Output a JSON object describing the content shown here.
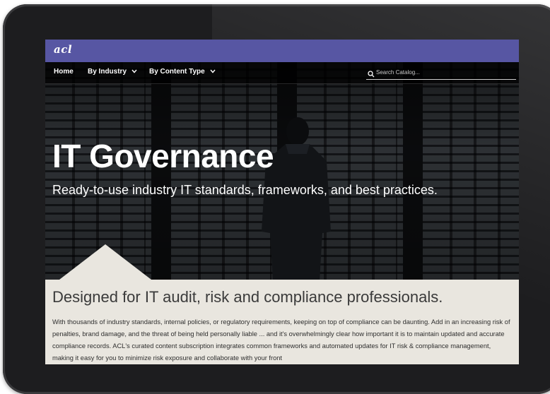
{
  "brand": {
    "logo_text": "acl"
  },
  "nav": {
    "home_label": "Home",
    "by_industry_label": "By Industry",
    "by_content_type_label": "By Content Type",
    "search_placeholder": "Search Catalog..."
  },
  "hero": {
    "title": "IT Governance",
    "subtitle": "Ready-to-use industry IT standards, frameworks, and best practices."
  },
  "content": {
    "heading": "Designed for IT audit, risk and compliance professionals.",
    "body": "With thousands of industry standards, internal policies, or regulatory requirements, keeping on top of compliance can be daunting. Add in an increasing risk of penalties, brand damage, and the threat of being held personally liable ... and it's overwhelmingly clear how important it is to maintain updated and accurate compliance records. ACL's curated content subscription integrates common frameworks and automated updates for IT risk & compliance management, making it easy for you to minimize risk exposure and collaborate with your front"
  },
  "colors": {
    "brand_bar": "#5756a3",
    "content_bg": "#e9e6df",
    "frame": "#1d1d1f"
  },
  "icons": {
    "search": "search-icon",
    "dropdown": "chevron-down-icon"
  }
}
